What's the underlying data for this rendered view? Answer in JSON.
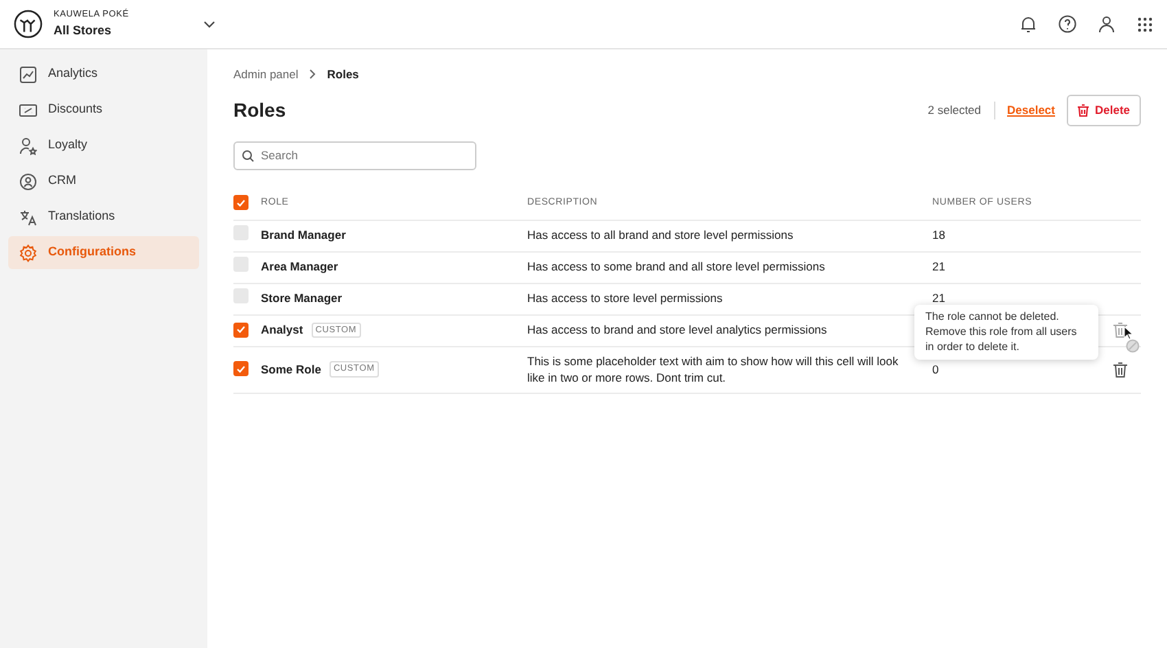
{
  "header": {
    "brand": "KAUWELA POKÉ",
    "store": "All Stores"
  },
  "sidebar": {
    "items": [
      {
        "label": "Analytics",
        "selected": false
      },
      {
        "label": "Discounts",
        "selected": false
      },
      {
        "label": "Loyalty",
        "selected": false
      },
      {
        "label": "CRM",
        "selected": false
      },
      {
        "label": "Translations",
        "selected": false
      },
      {
        "label": "Configurations",
        "selected": true
      }
    ]
  },
  "breadcrumb": [
    "Admin panel",
    "Roles"
  ],
  "title": "Roles",
  "selection": {
    "count": "2 selected",
    "deselect": "Deselect",
    "delete": "Delete"
  },
  "search": {
    "placeholder": "Search"
  },
  "table": {
    "all_checked": true,
    "columns": [
      "ROLE",
      "DESCRIPTION",
      "NUMBER OF USERS"
    ],
    "rows": [
      {
        "name": "Brand Manager",
        "checked": false,
        "description": "Has access to all brand and store level permissions",
        "users": "18",
        "trash": false
      },
      {
        "name": "Area Manager",
        "checked": false,
        "description": "Has access to some brand and all store level permissions",
        "users": "21",
        "trash": false
      },
      {
        "name": "Store Manager",
        "checked": false,
        "description": "Has access to store level permissions",
        "users": "21",
        "trash": false
      },
      {
        "name": "Analyst",
        "tag": "CUSTOM",
        "checked": true,
        "description": "Has access to brand and store level analytics permissions",
        "trash": true,
        "disabled": true,
        "tooltip": "The role cannot be deleted. Remove this role from all users in order to delete it."
      },
      {
        "name": "Some Role",
        "tag": "CUSTOM",
        "checked": true,
        "description": "This is some placeholder text with aim to show how will this cell will look like in two or more rows. Dont trim cut.",
        "users": "0",
        "trash": true,
        "disabled": false
      }
    ]
  }
}
